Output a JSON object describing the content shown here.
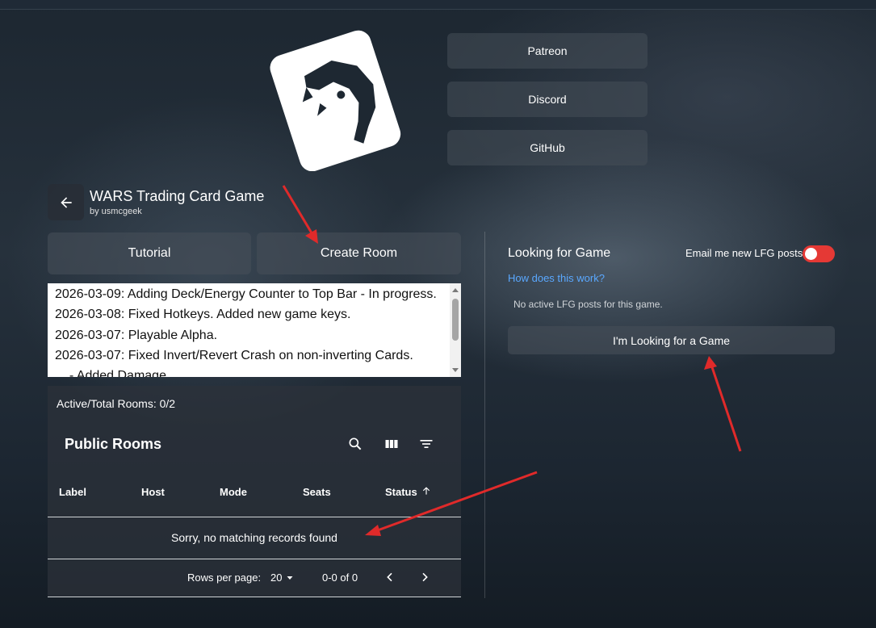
{
  "links": {
    "patreon": "Patreon",
    "discord": "Discord",
    "github": "GitHub"
  },
  "game": {
    "title": "WARS Trading Card Game",
    "author": "by usmcgeek"
  },
  "actions": {
    "tutorial": "Tutorial",
    "create_room": "Create Room"
  },
  "news": [
    "2026-03-09: Adding Deck/Energy Counter to Top Bar - In progress.",
    "2026-03-08: Fixed Hotkeys. Added new game keys.",
    "2026-03-07: Playable Alpha.",
    "2026-03-07: Fixed Invert/Revert Crash on non-inverting Cards.",
    "  - Added Damage"
  ],
  "rooms": {
    "active_total": "Active/Total Rooms: 0/2",
    "title": "Public Rooms",
    "columns": [
      "Label",
      "Host",
      "Mode",
      "Seats",
      "Status"
    ],
    "empty_message": "Sorry, no matching records found",
    "rows_per_page_label": "Rows per page:",
    "rows_per_page_value": "20",
    "range": "0-0 of 0"
  },
  "lfg": {
    "title": "Looking for Game",
    "help_link": "How does this work?",
    "email_label": "Email me new LFG posts",
    "email_enabled": false,
    "empty": "No active LFG posts for this game.",
    "button": "I'm Looking for a Game"
  },
  "icons": {
    "back": "arrow-left-icon",
    "search": "search-icon",
    "columns": "view-column-icon",
    "filter": "filter-icon",
    "sort": "arrow-up-icon",
    "dropdown": "caret-down-icon",
    "prev": "chevron-left-icon",
    "next": "chevron-right-icon",
    "logo": "dragon-card-logo"
  },
  "colors": {
    "accent_link": "#5aa8ff",
    "toggle": "#e53935",
    "annotation_arrow": "#e02a2a"
  }
}
